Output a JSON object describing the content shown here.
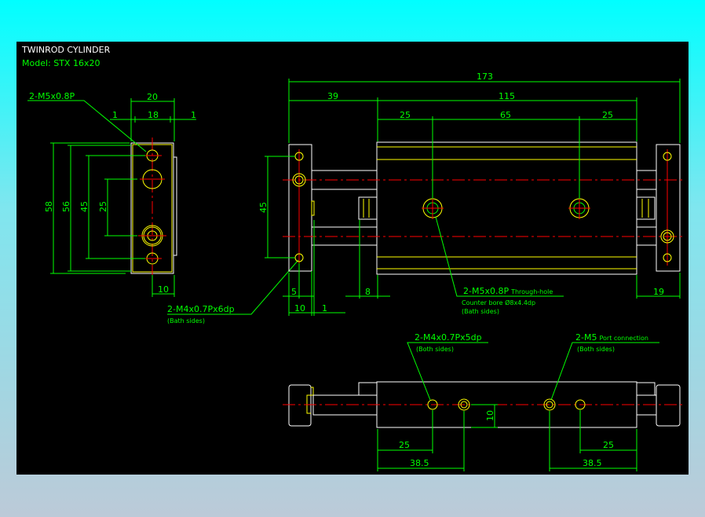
{
  "title": "TWINROD CYLINDER",
  "model": "Model: STX 16x20",
  "colors": {
    "background": "#000000",
    "outline": "#ffffff",
    "feature": "#ffff00",
    "dimension": "#00ff00",
    "centerline": "#ff0000"
  },
  "side_view": {
    "dims": {
      "width_total": "20",
      "width_inner": "18",
      "gap_left": "1",
      "gap_right": "1",
      "h58": "58",
      "h56": "56",
      "h45": "45",
      "h25": "25",
      "bottom10": "10"
    },
    "callout_top": "2-M5x0.8P",
    "callout_bottom": "2-M4x0.7Px6dp",
    "callout_bottom_note": "(Bath sides)"
  },
  "front_view": {
    "dims": {
      "overall": "173",
      "left": "39",
      "body": "115",
      "hole_left": "25",
      "hole_pitch": "65",
      "hole_right": "25",
      "height45": "45",
      "d5": "5",
      "d10": "10",
      "d1": "1",
      "d8": "8",
      "d19": "19"
    },
    "callout_line1": "2-M5x0.8P",
    "callout_line1b": "Through-hole",
    "callout_line2": "Counter bore Ø8x4.4dp",
    "callout_line3": "(Bath sides)"
  },
  "bottom_view": {
    "dims": {
      "height10": "10",
      "left25": "25",
      "left38": "38.5",
      "right25": "25",
      "right38": "38.5"
    },
    "callout_left": "2-M4x0.7Px5dp",
    "callout_left_note": "(Both sides)",
    "callout_right": "2-M5",
    "callout_right_b": "Port connection",
    "callout_right_note": "(Both sides)"
  }
}
